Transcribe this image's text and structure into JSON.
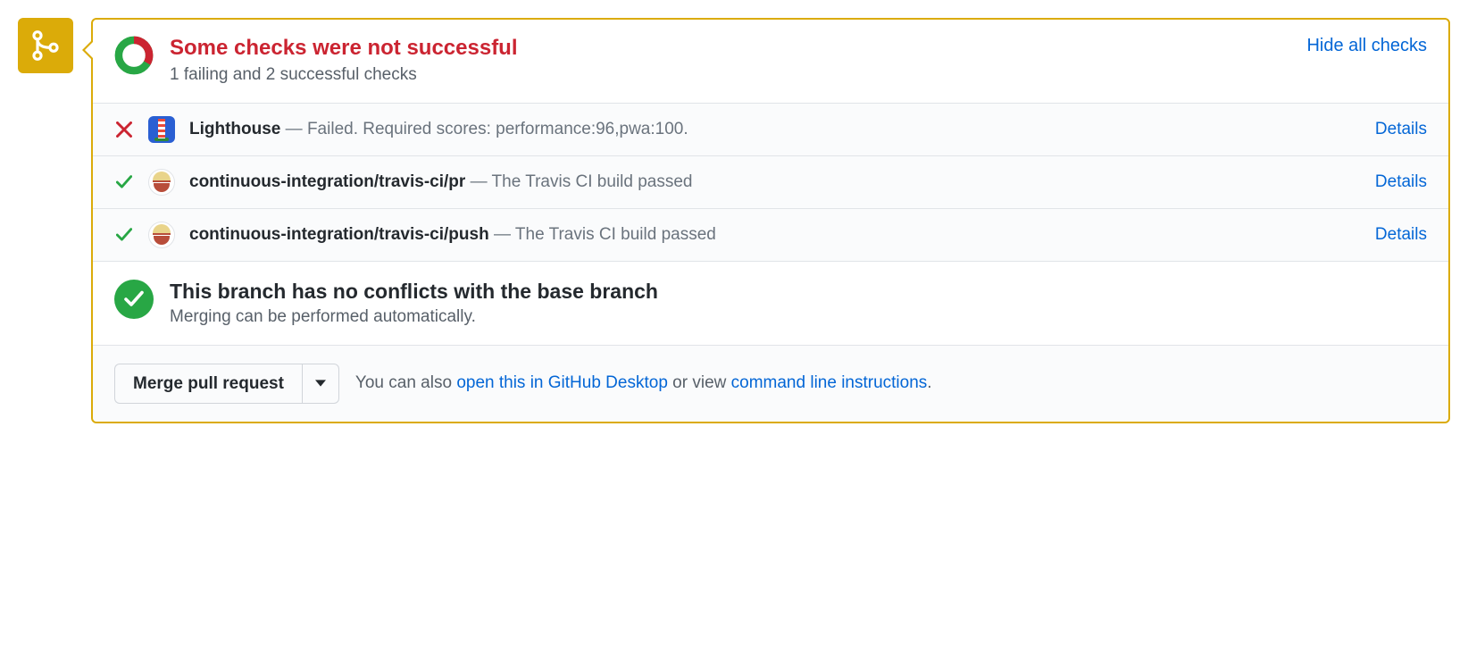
{
  "status": {
    "title": "Some checks were not successful",
    "subtitle": "1 failing and 2 successful checks",
    "hide_link": "Hide all checks"
  },
  "checks": [
    {
      "state": "fail",
      "avatar": "lighthouse",
      "name": "Lighthouse",
      "message": "Failed. Required scores: performance:96,pwa:100.",
      "details": "Details"
    },
    {
      "state": "pass",
      "avatar": "travis",
      "name": "continuous-integration/travis-ci/pr",
      "message": "The Travis CI build passed",
      "details": "Details"
    },
    {
      "state": "pass",
      "avatar": "travis",
      "name": "continuous-integration/travis-ci/push",
      "message": "The Travis CI build passed",
      "details": "Details"
    }
  ],
  "no_conflicts": {
    "title": "This branch has no conflicts with the base branch",
    "subtitle": "Merging can be performed automatically."
  },
  "footer": {
    "merge_button": "Merge pull request",
    "text_prefix": "You can also ",
    "desktop_link": "open this in GitHub Desktop",
    "text_mid": " or view ",
    "cli_link": "command line instructions",
    "text_suffix": "."
  }
}
